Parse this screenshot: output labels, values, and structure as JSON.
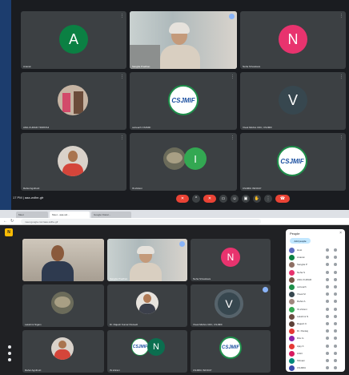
{
  "top_meeting": {
    "tiles": [
      {
        "name": "Ananat",
        "avatar_letter": "A",
        "color": "#0b8043"
      },
      {
        "name": "Sangita Pradhan",
        "type": "video"
      },
      {
        "name": "Neha Srivastava",
        "avatar_letter": "N",
        "color": "#e8336e"
      },
      {
        "name": "ANIL KUMAR TRIPATHI",
        "type": "photo"
      },
      {
        "name": "outreach CSJMIF",
        "type": "logo"
      },
      {
        "name": "Vivek Mishra CDC, CSJMIF",
        "avatar_letter": "V",
        "color": "#37474f"
      },
      {
        "name": "Rahul Agnihotri",
        "type": "photo"
      },
      {
        "name": "IS shirani",
        "avatar_letter": "I",
        "color": "#33a852"
      },
      {
        "name": "CSJMIU INFOCP",
        "type": "logo"
      }
    ],
    "logo_text": "CSJMIF",
    "bar": {
      "time": "17 PM | aaa-wdhe-gfr"
    }
  },
  "bottom_meeting": {
    "browser_tabs": [
      "Meet",
      "Meet - aaa-wd...",
      "Google Classr..."
    ],
    "url": "meet.google.com/aaa-wdhe-gfr",
    "brand_letter": "N",
    "tiles": [
      {
        "name": "",
        "type": "video"
      },
      {
        "name": "Sangita Pradhan",
        "type": "video"
      },
      {
        "name": "Neha Srivastava",
        "avatar_letter": "N",
        "color": "#e8336e"
      },
      {
        "name": "Lakshmi Nigam",
        "type": "photo"
      },
      {
        "name": "Dr. Rajesh Kumar Dwivedi",
        "type": "photo"
      },
      {
        "name": "Vivek Mishra CDC, CSJMIF",
        "avatar_letter": "V",
        "color": "#37474f"
      },
      {
        "name": "Rahul Agnihotri",
        "type": "photo"
      },
      {
        "name": "IS shirani",
        "avatar_letter": "N",
        "color": "#0b6e4f"
      },
      {
        "name": "CSJMIU INFOCP",
        "type": "logo"
      }
    ],
    "people_panel": {
      "title": "People",
      "add_label": "Add people",
      "rows": [
        {
          "name": "Host",
          "color": "#5c6bc0"
        },
        {
          "name": "Ananat",
          "color": "#0b8043"
        },
        {
          "name": "Sangita P",
          "color": "#8d6e63"
        },
        {
          "name": "Neha S",
          "color": "#e8336e"
        },
        {
          "name": "ANIL KUMAR",
          "color": "#795548"
        },
        {
          "name": "outreach",
          "color": "#1e8f4a"
        },
        {
          "name": "Vivek M",
          "color": "#37474f"
        },
        {
          "name": "Rahul A",
          "color": "#a1887f"
        },
        {
          "name": "IS shirani",
          "color": "#33a852"
        },
        {
          "name": "Lakshmi N",
          "color": "#6d4c41"
        },
        {
          "name": "Rajesh K",
          "color": "#5d4037"
        },
        {
          "name": "Dr. Pankaj",
          "color": "#e53935"
        },
        {
          "name": "Ritu G",
          "color": "#8e24aa"
        },
        {
          "name": "Ajay K",
          "color": "#e53935"
        },
        {
          "name": "Ankit",
          "color": "#d81b60"
        },
        {
          "name": "Shivani",
          "color": "#00897b"
        },
        {
          "name": "CSJMIU",
          "color": "#3949ab"
        }
      ]
    }
  }
}
